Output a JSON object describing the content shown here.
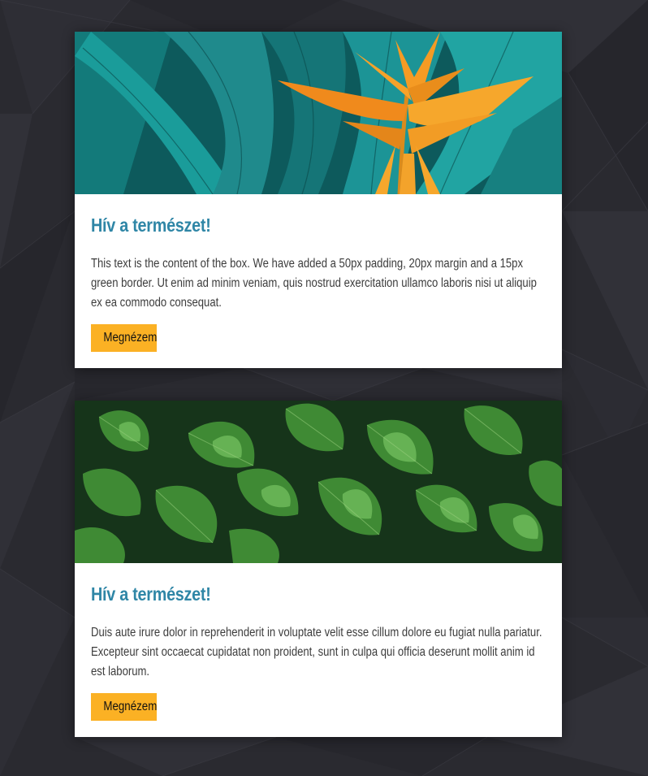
{
  "colors": {
    "background": "#2a2a30",
    "title": "#2f86a6",
    "button": "#fbb124",
    "text": "#3c3c3c"
  },
  "cards": [
    {
      "image": "tropical-leaves-bird-of-paradise-photo",
      "title": "Hív a természet!",
      "text": "This text is the content of the box. We have added a 50px padding, 20px margin and a 15px green border. Ut enim ad minim veniam, quis nostrud exercitation ullamco laboris nisi ut aliquip ex ea commodo consequat.",
      "button_label": "Megnézem"
    },
    {
      "image": "green-caladium-leaves-photo",
      "title": "Hív a természet!",
      "text": "Duis aute irure dolor in reprehenderit in voluptate velit esse cillum dolore eu fugiat nulla pariatur. Excepteur sint occaecat cupidatat non proident, sunt in culpa qui officia deserunt mollit anim id est laborum.",
      "button_label": "Megnézem"
    }
  ]
}
